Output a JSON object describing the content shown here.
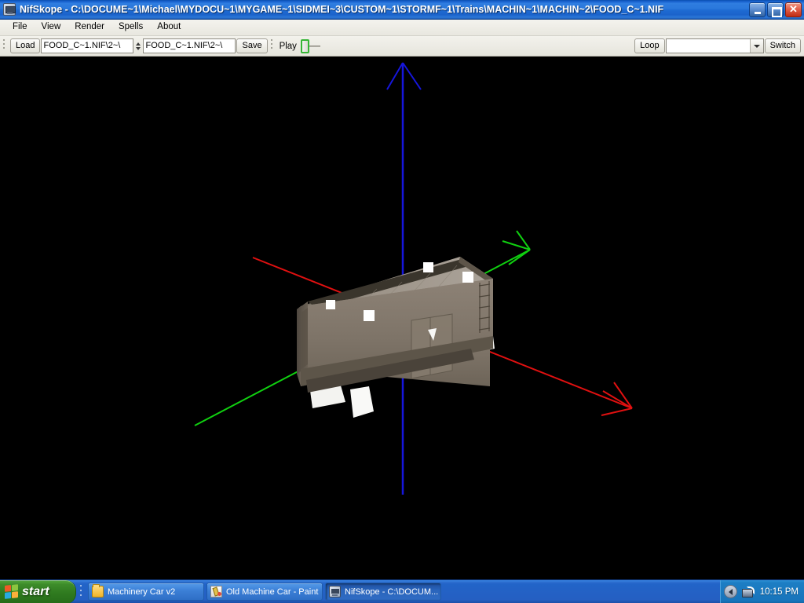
{
  "window": {
    "title": "NifSkope - C:\\DOCUME~1\\Michael\\MYDOCU~1\\MYGAME~1\\SIDMEI~3\\CUSTOM~1\\STORMF~1\\Trains\\MACHIN~1\\MACHIN~2\\FOOD_C~1.NIF",
    "app_icon": "nifskope-icon",
    "controls": {
      "minimize": "minimize-icon",
      "maximize": "restore-icon",
      "close": "✕"
    }
  },
  "menubar": {
    "items": [
      {
        "label": "File"
      },
      {
        "label": "View"
      },
      {
        "label": "Render"
      },
      {
        "label": "Spells"
      },
      {
        "label": "About"
      }
    ]
  },
  "toolbar": {
    "load_label": "Load",
    "load_path_value": "\\~2\\FOOD_C~1.NIF",
    "load_path_placeholder": "",
    "save_path_value": "\\~2\\FOOD_C~1.NIF",
    "save_path_placeholder": "",
    "save_label": "Save",
    "play_label": "Play",
    "loop_label": "Loop",
    "animation_value": "",
    "animation_placeholder": "",
    "switch_label": "Switch"
  },
  "viewport": {
    "background_color": "#000000",
    "axes": {
      "x_color": "#e01010",
      "y_color": "#10d010",
      "z_color": "#1616dc"
    },
    "model_name": "food-car-boxcar-model"
  },
  "taskbar": {
    "start_label": "start",
    "buttons": [
      {
        "icon": "folder-icon",
        "label": "Machinery Car v2",
        "active": false
      },
      {
        "icon": "paint-icon",
        "label": "Old Machine Car - Paint",
        "active": false
      },
      {
        "icon": "nifskope-icon",
        "label": "NifSkope - C:\\DOCUM...",
        "active": true
      }
    ],
    "tray": {
      "chevron": "show-hidden-icons-icon",
      "network": "network-icon",
      "clock": "10:15 PM"
    }
  }
}
